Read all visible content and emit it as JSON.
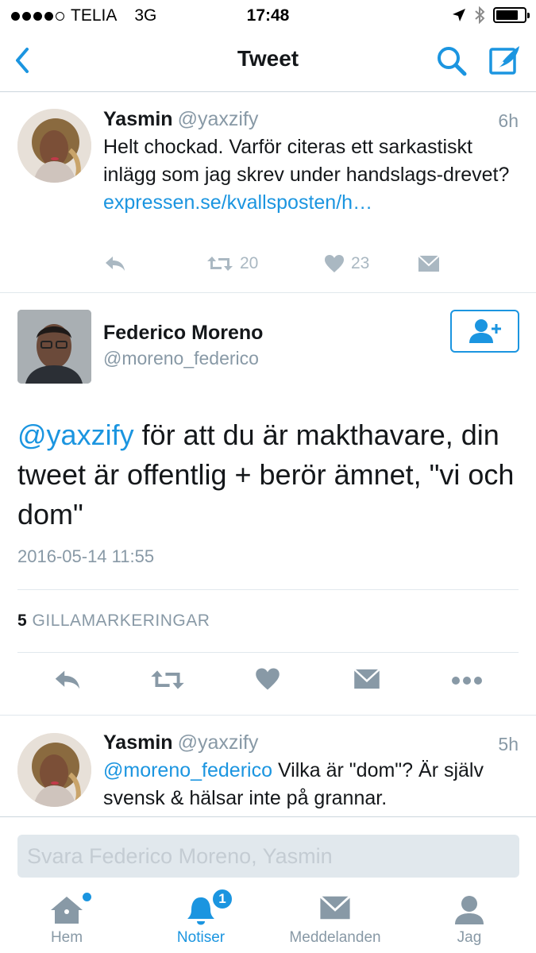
{
  "status_bar": {
    "carrier": "TELIA",
    "network": "3G",
    "time": "17:48"
  },
  "nav": {
    "title": "Tweet"
  },
  "tweets_top": {
    "name": "Yasmin",
    "handle": "@yaxzify",
    "time": "6h",
    "text": "Helt chockad. Varför citeras ett sarkastiskt inlägg som jag skrev under handslags-drevet? ",
    "link": "expressen.se/kvallsposten/h…",
    "retweets": "20",
    "likes": "23"
  },
  "main_tweet": {
    "name": "Federico Moreno",
    "handle": "@moreno_federico",
    "mention": "@yaxzify",
    "text": " för att du är makthavare, din tweet är offentlig + berör ämnet, \"vi och dom\"",
    "date": "2016-05-14 11:55",
    "likes_count": "5",
    "likes_label": "GILLAMARKERINGAR"
  },
  "reply_tweet": {
    "name": "Yasmin",
    "handle": "@yaxzify",
    "time": "5h",
    "mention": "@moreno_federico",
    "text": " Vilka är \"dom\"? Är själv svensk & hälsar inte på grannar."
  },
  "reply_bar": {
    "placeholder": "Svara Federico Moreno, Yasmin"
  },
  "tabs": {
    "home": "Hem",
    "notifications": "Notiser",
    "notifications_badge": "1",
    "messages": "Meddelanden",
    "me": "Jag"
  },
  "colors": {
    "accent": "#1b95e0",
    "muted": "#8899a6",
    "icon_gray": "#aab8c2"
  }
}
